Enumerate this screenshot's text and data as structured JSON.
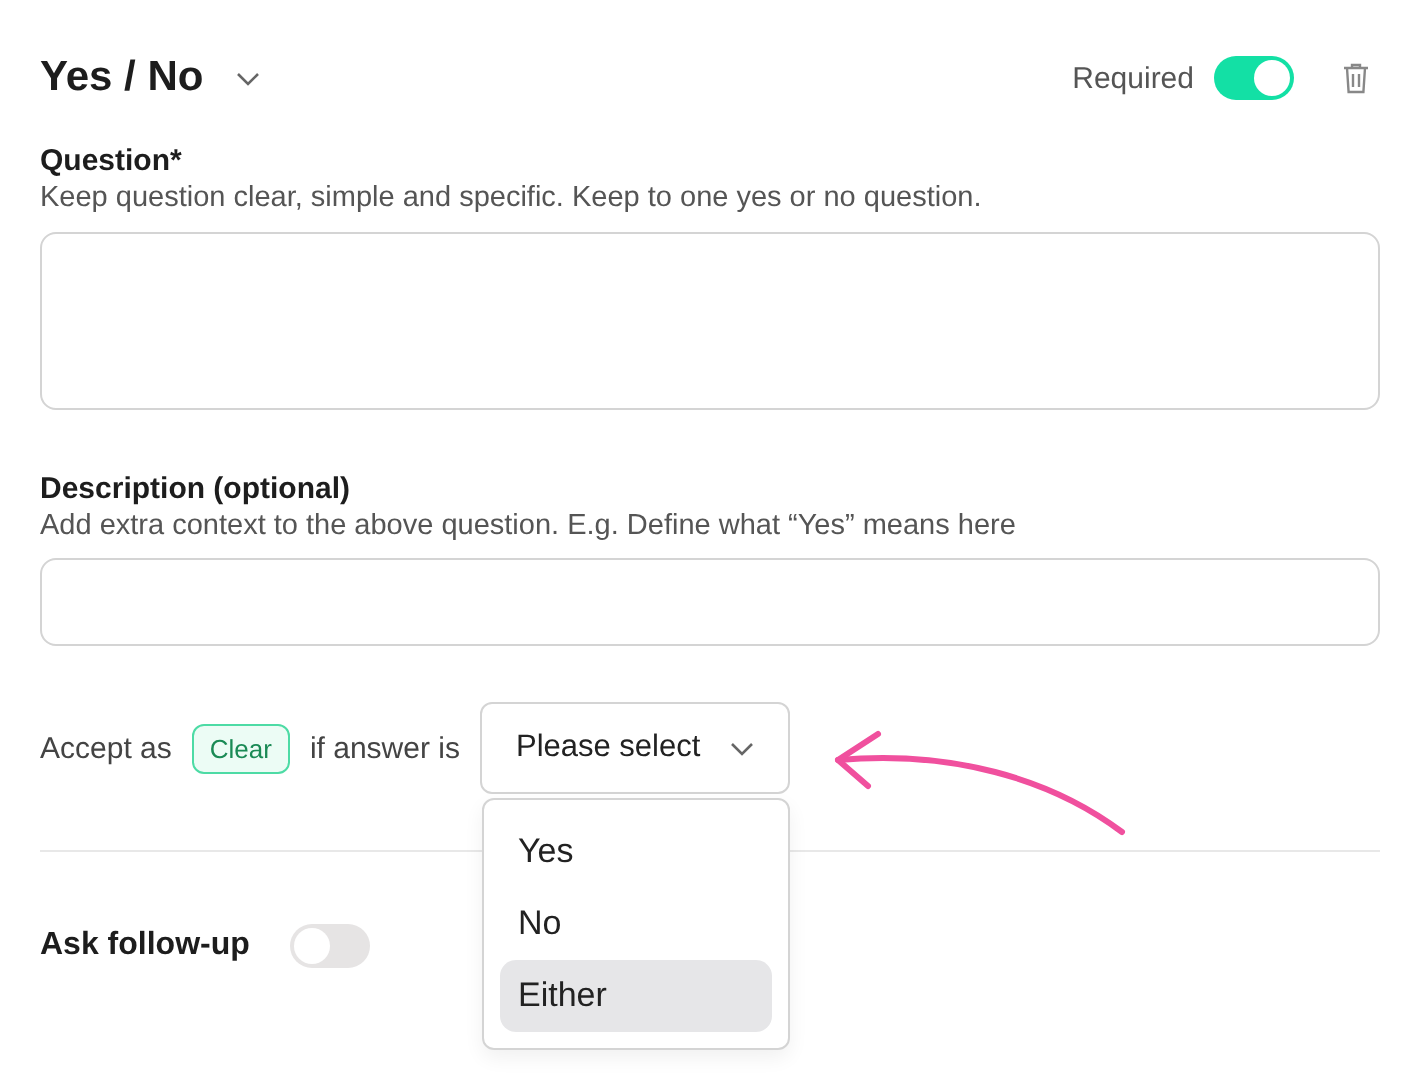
{
  "header": {
    "title": "Yes / No",
    "required_label": "Required",
    "required": true
  },
  "question": {
    "label": "Question*",
    "hint": "Keep question clear, simple and specific. Keep to one yes or no question."
  },
  "description": {
    "label": "Description (optional)",
    "hint": "Add extra context to the above question. E.g. Define what “Yes” means here"
  },
  "accept": {
    "prefix": "Accept as",
    "tag": "Clear",
    "middle": "if answer is",
    "select": {
      "placeholder": "Please select",
      "expanded": true,
      "options": [
        {
          "label": "Yes",
          "highlighted": false
        },
        {
          "label": "No",
          "highlighted": false
        },
        {
          "label": "Either",
          "highlighted": true
        }
      ]
    }
  },
  "follow_up": {
    "label": "Ask follow-up",
    "on": false
  }
}
